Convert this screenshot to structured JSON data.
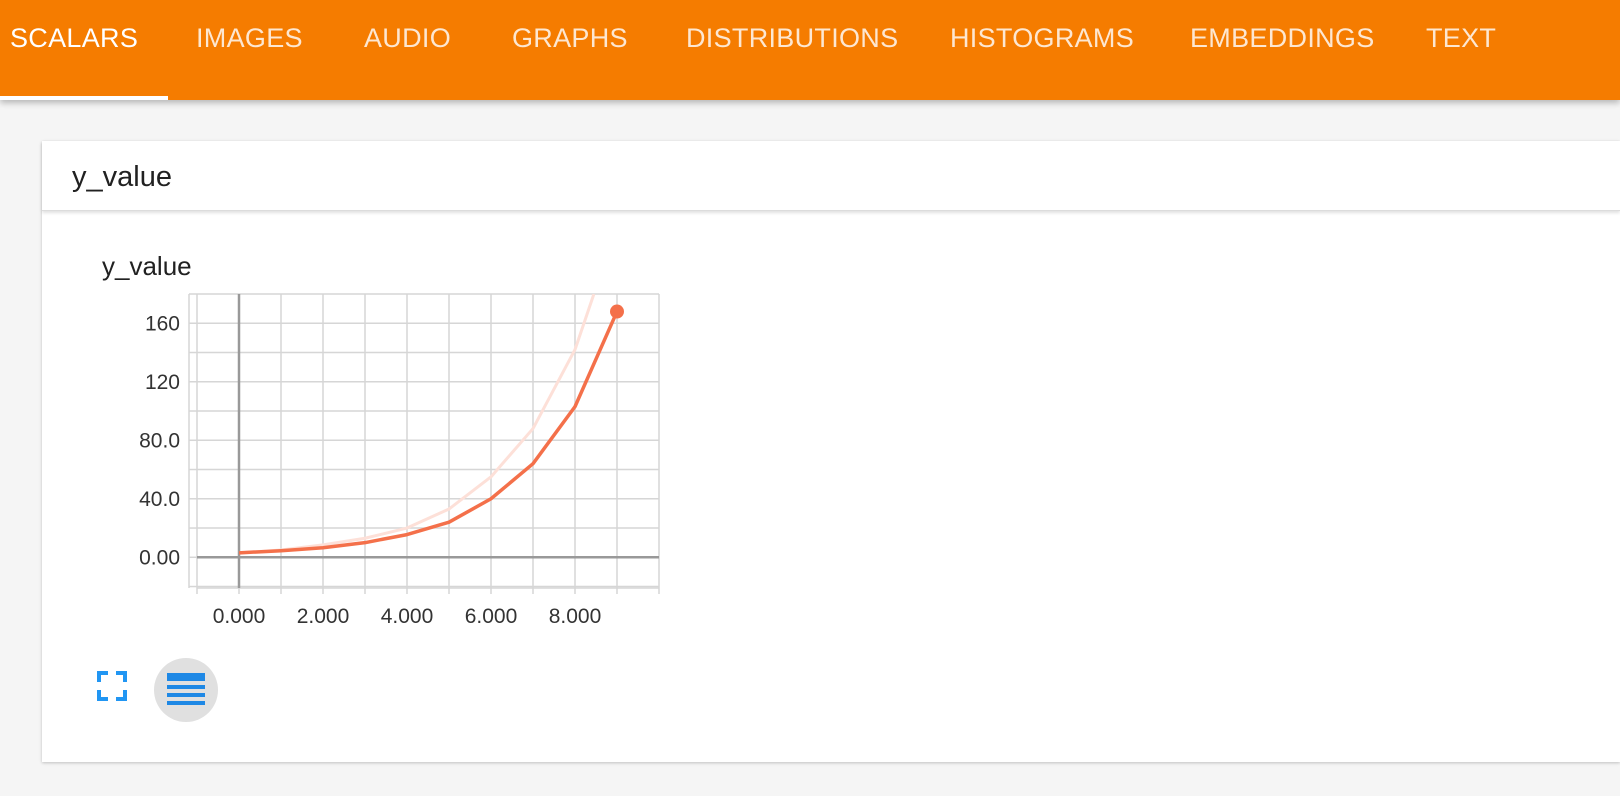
{
  "nav": {
    "tabs": [
      {
        "label": "SCALARS",
        "active": true
      },
      {
        "label": "IMAGES",
        "active": false
      },
      {
        "label": "AUDIO",
        "active": false
      },
      {
        "label": "GRAPHS",
        "active": false
      },
      {
        "label": "DISTRIBUTIONS",
        "active": false
      },
      {
        "label": "HISTOGRAMS",
        "active": false
      },
      {
        "label": "EMBEDDINGS",
        "active": false
      },
      {
        "label": "TEXT",
        "active": false
      }
    ]
  },
  "card": {
    "title": "y_value"
  },
  "colors": {
    "header_bg": "#f57c00",
    "smoothed_line": "#f4704a",
    "raw_line": "#fde0d8",
    "grid": "#d6d6d6",
    "axis": "#999999",
    "button_icon": "#2196f3"
  },
  "icons": {
    "expand": "fullscreen-expand-icon",
    "data_table": "data-table-list-icon"
  },
  "chart_data": {
    "type": "line",
    "title": "y_value",
    "xlabel": "",
    "ylabel": "",
    "x_tick_labels": [
      "0.000",
      "2.000",
      "4.000",
      "6.000",
      "8.000"
    ],
    "y_tick_labels": [
      "0.00",
      "40.0",
      "80.0",
      "120",
      "160"
    ],
    "xlim": [
      -1,
      10
    ],
    "ylim": [
      -21,
      180
    ],
    "grid": true,
    "legend": "none",
    "series": [
      {
        "role": "raw",
        "x": [
          0,
          1,
          2,
          3,
          4,
          5,
          6,
          7,
          8,
          8.45
        ],
        "y": [
          3,
          5,
          8.5,
          13,
          20,
          33,
          55,
          88,
          142,
          180
        ]
      },
      {
        "role": "smoothed",
        "x": [
          0,
          1,
          2,
          3,
          4,
          5,
          6,
          7,
          8,
          9
        ],
        "y": [
          3,
          4.5,
          6.5,
          10,
          15.5,
          24,
          40,
          64,
          103,
          168
        ]
      }
    ]
  }
}
